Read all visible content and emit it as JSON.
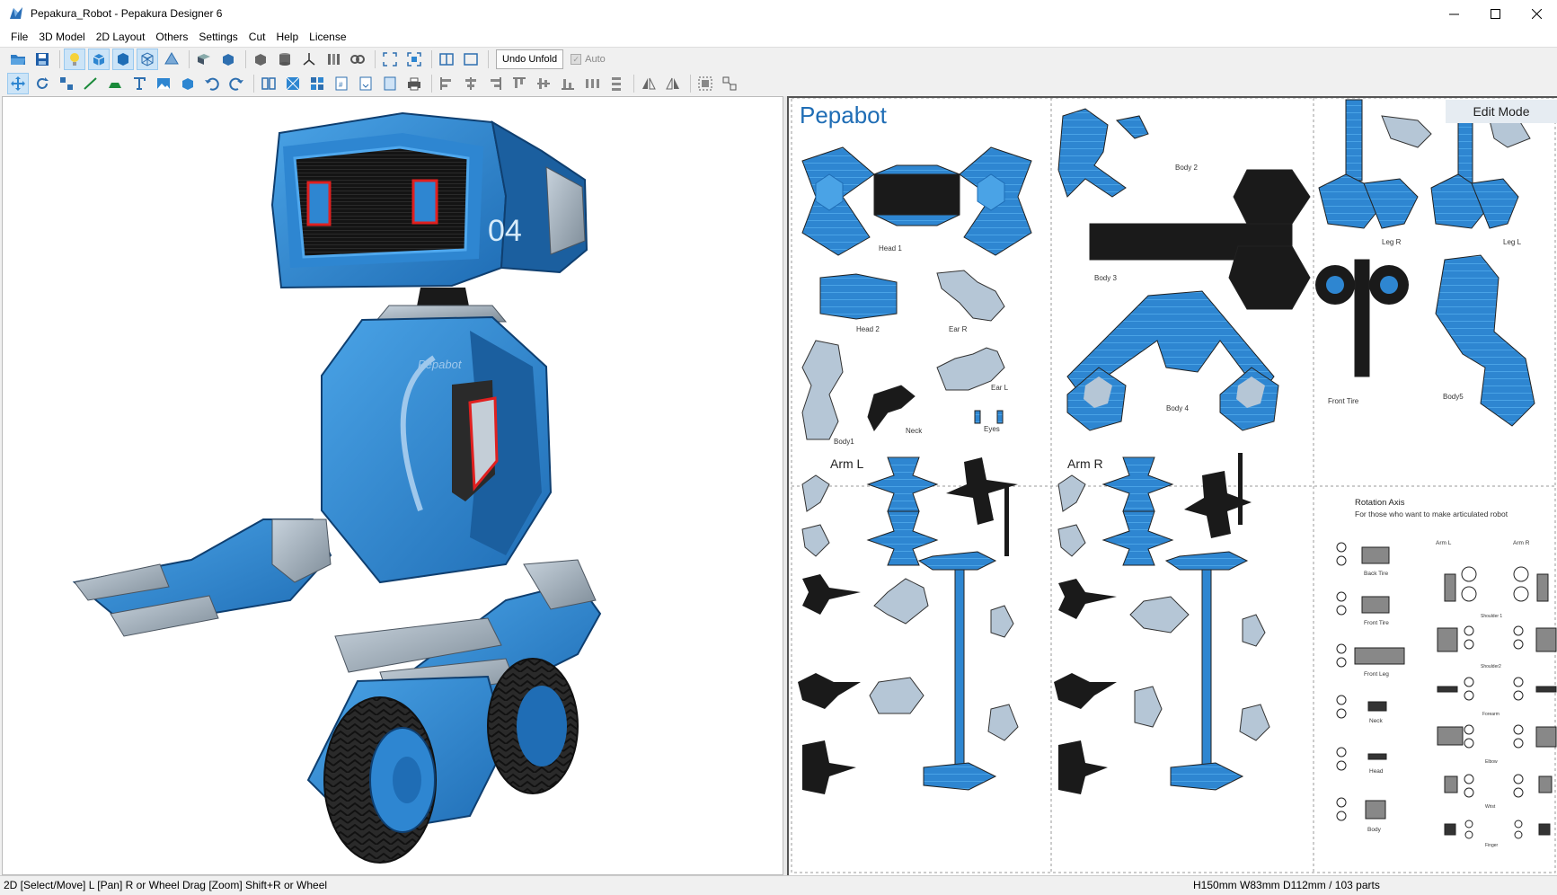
{
  "window": {
    "title": "Pepakura_Robot - Pepakura Designer 6",
    "minimize_icon": "minimize-icon",
    "maximize_icon": "maximize-icon",
    "close_icon": "close-icon"
  },
  "menu": [
    "File",
    "3D Model",
    "2D Layout",
    "Others",
    "Settings",
    "Cut",
    "Help",
    "License"
  ],
  "toolbar": {
    "undo_unfold": "Undo Unfold",
    "auto": "Auto"
  },
  "view3d": {
    "robot_logo_text": "Pepabot",
    "robot_badge": "04"
  },
  "view2d": {
    "edit_mode": "Edit Mode",
    "sheet_title": "Pepabot",
    "parts": {
      "head1": "Head 1",
      "head2": "Head 2",
      "ear_r": "Ear R",
      "ear_l": "Ear L",
      "body1": "Body1",
      "neck": "Neck",
      "eyes": "Eyes",
      "body2": "Body 2",
      "body3": "Body 3",
      "body4": "Body 4",
      "leg_r": "Leg R",
      "leg_l": "Leg L",
      "front_tire": "Front Tire",
      "body5": "Body5",
      "arm_l": "Arm L",
      "arm_r": "Arm R"
    },
    "rotation": {
      "title": "Rotation Axis",
      "subtitle": "For those who want to make articulated robot",
      "col_arm_l": "Arm L",
      "col_arm_r": "Arm R",
      "back_tire": "Back Tire",
      "front_tire": "Front Tire",
      "front_leg": "Front Leg",
      "neck": "Neck",
      "head": "Head",
      "body": "Body",
      "shoulder1": "Shoulder 1",
      "shoulder2": "Shoulder2",
      "forearm": "Forearm",
      "elbow": "Elbow",
      "wrist": "Wrist",
      "finger": "Finger"
    }
  },
  "status": {
    "left": "2D [Select/Move] L [Pan] R or Wheel Drag [Zoom] Shift+R or Wheel",
    "right": "H150mm W83mm D112mm / 103 parts"
  },
  "colors": {
    "accent_blue": "#2e86d1",
    "title_blue": "#1f6db5",
    "dark": "#1a1a1a",
    "eye_red": "#e02020"
  }
}
